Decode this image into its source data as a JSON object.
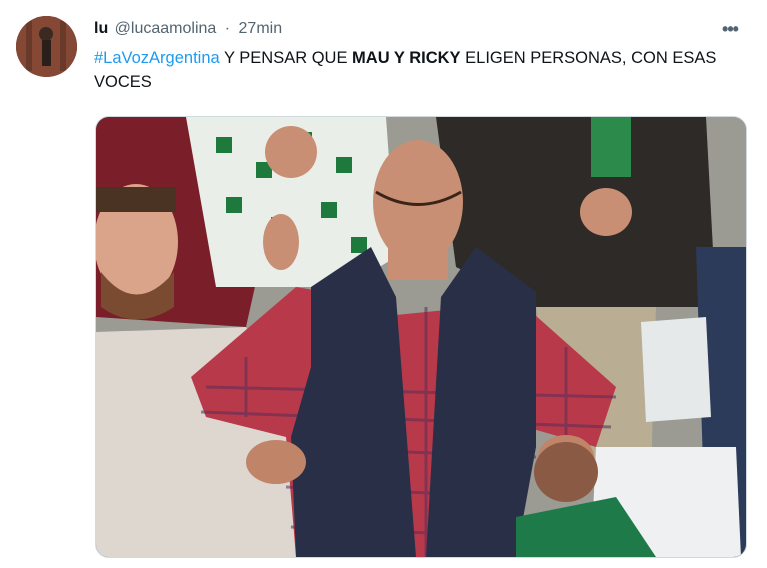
{
  "tweet": {
    "author": {
      "name": "lu",
      "handle": "@lucaamolina",
      "separator": "·",
      "time": "27min"
    },
    "more_label": "•••",
    "text": {
      "hashtag": "#LaVozArgentina",
      "part1": " Y PENSAR QUE ",
      "bold": "MAU Y RICKY",
      "part2": " ELIGEN PERSONAS, CON ESAS VOCES"
    },
    "media": {
      "kind": "photo",
      "subject": "man-hands-on-hips-meme"
    }
  }
}
